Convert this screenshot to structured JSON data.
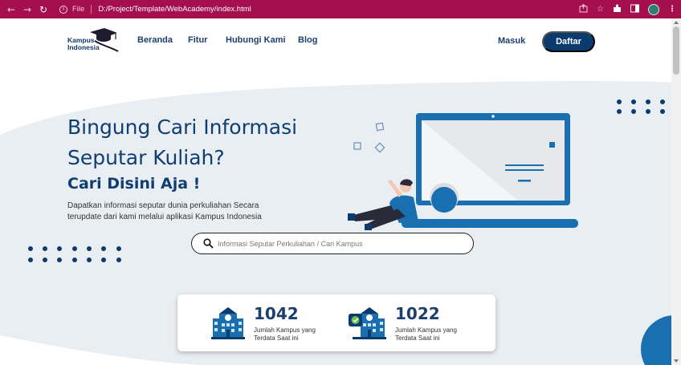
{
  "browser": {
    "file_label": "File",
    "url": "D:/Project/Template/WebAcademy/index.html"
  },
  "logo": {
    "line1": "Kampus",
    "line2": "Indonesia"
  },
  "nav": {
    "links": [
      "Beranda",
      "Fitur",
      "Hubungi Kami",
      "Blog"
    ],
    "login": "Masuk",
    "register": "Daftar"
  },
  "hero": {
    "title": "Bingung Cari Informasi Seputar Kuliah?",
    "subtitle": "Cari Disini Aja !",
    "description": "Dapatkan informasi seputar dunia perkuliahan Secara terupdate dari kami melalui aplikasi Kampus Indonesia",
    "search_placeholder": "Informasi Seputar Perkuliahan / Cari Kampus"
  },
  "stats": [
    {
      "value": "1042",
      "label": "Jumlah Kampus yang Terdata Saat ini"
    },
    {
      "value": "1022",
      "label": "Jumlah Kampus yang Terdata Saat ini"
    }
  ],
  "colors": {
    "chrome": "#a50f4d",
    "primary": "#0b3a6e",
    "accent": "#1a6fb0",
    "hero_bg": "#e9eef2"
  }
}
